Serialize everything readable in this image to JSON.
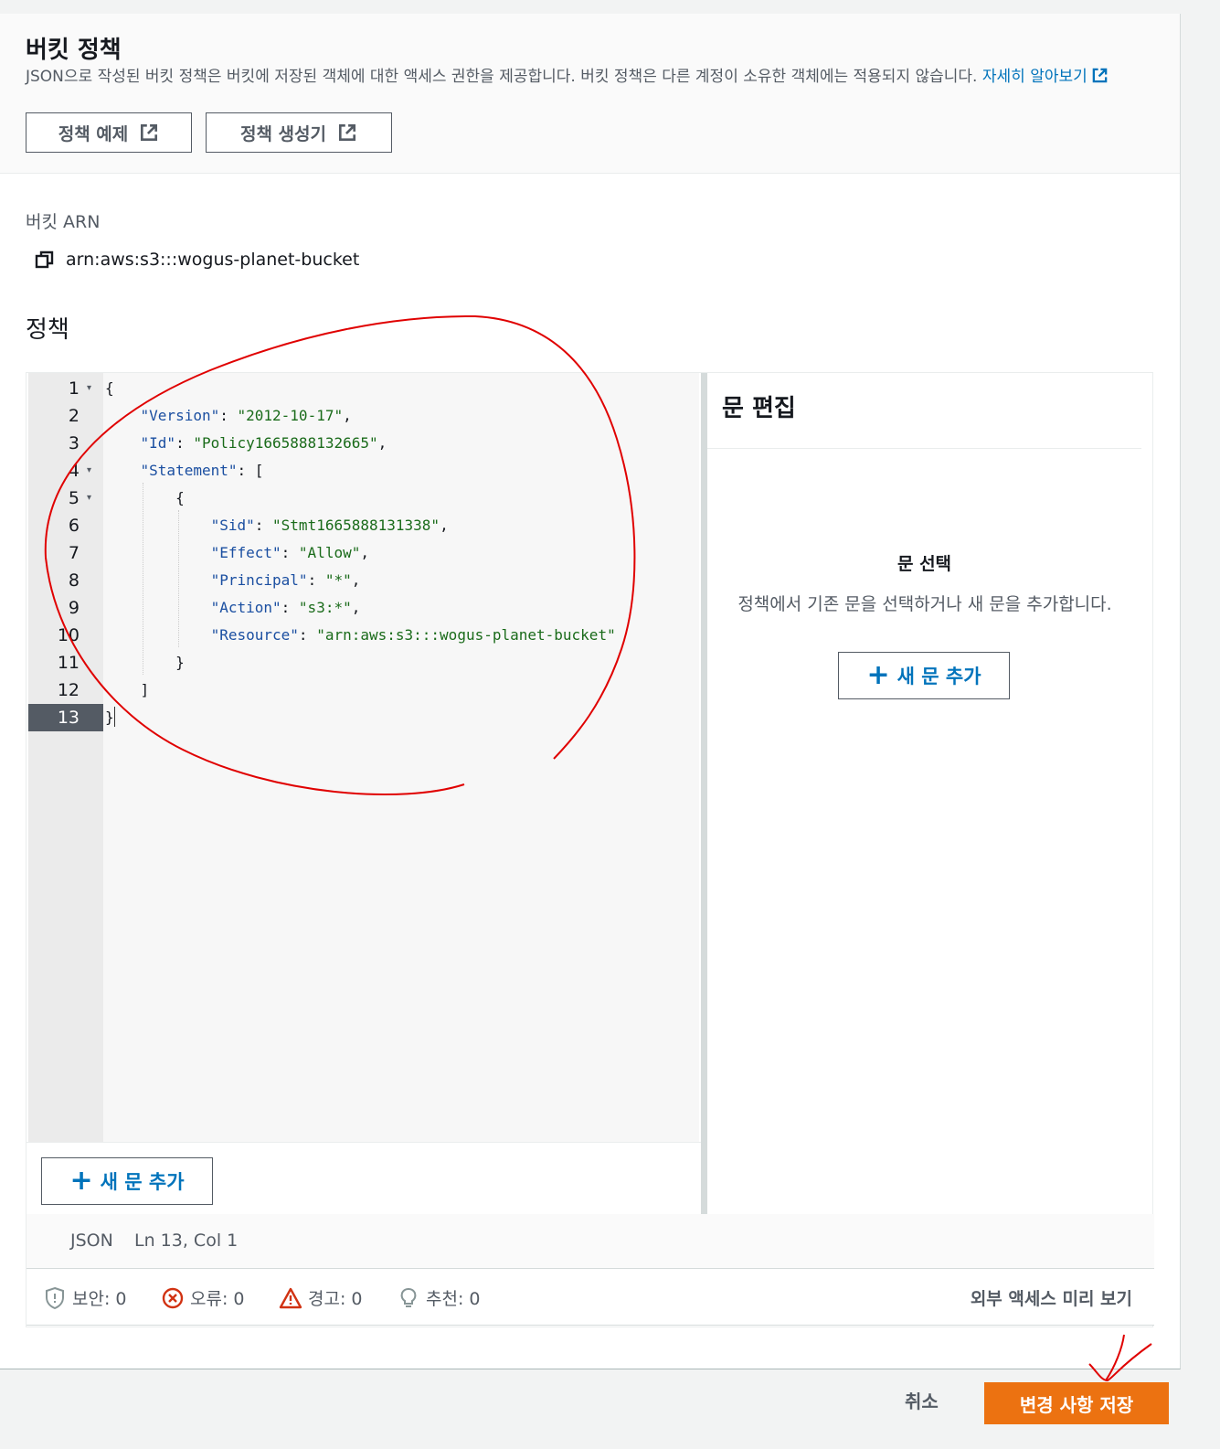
{
  "header": {
    "title": "버킷 정책",
    "description": "JSON으로 작성된 버킷 정책은 버킷에 저장된 객체에 대한 액세스 권한을 제공합니다. 버킷 정책은 다른 계정이 소유한 객체에는 적용되지 않습니다.",
    "learn_more": "자세히 알아보기",
    "policy_examples_button": "정책 예제",
    "policy_generator_button": "정책 생성기"
  },
  "arn": {
    "label": "버킷 ARN",
    "value": "arn:aws:s3:::wogus-planet-bucket"
  },
  "policy": {
    "label": "정책",
    "lines": [
      {
        "no": "1",
        "fold": true
      },
      {
        "no": "2",
        "fold": false
      },
      {
        "no": "3",
        "fold": false
      },
      {
        "no": "4",
        "fold": true
      },
      {
        "no": "5",
        "fold": true
      },
      {
        "no": "6",
        "fold": false
      },
      {
        "no": "7",
        "fold": false
      },
      {
        "no": "8",
        "fold": false
      },
      {
        "no": "9",
        "fold": false
      },
      {
        "no": "10",
        "fold": false
      },
      {
        "no": "11",
        "fold": false
      },
      {
        "no": "12",
        "fold": false
      },
      {
        "no": "13",
        "fold": false
      }
    ],
    "code": {
      "version_key": "\"Version\"",
      "version_val": "\"2012-10-17\"",
      "id_key": "\"Id\"",
      "id_val": "\"Policy1665888132665\"",
      "statement_key": "\"Statement\"",
      "sid_key": "\"Sid\"",
      "sid_val": "\"Stmt1665888131338\"",
      "effect_key": "\"Effect\"",
      "effect_val": "\"Allow\"",
      "principal_key": "\"Principal\"",
      "principal_val": "\"*\"",
      "action_key": "\"Action\"",
      "action_val": "\"s3:*\"",
      "resource_key": "\"Resource\"",
      "resource_val": "\"arn:aws:s3:::wogus-planet-bucket\""
    },
    "active_line": "13"
  },
  "editor": {
    "add_statement_button": "새 문 추가",
    "mode": "JSON",
    "cursor_position": "Ln 13, Col 1"
  },
  "statement_pane": {
    "title": "문 편집",
    "choose_title": "문 선택",
    "choose_desc": "정책에서 기존 문을 선택하거나 새 문을 추가합니다.",
    "add_statement_button": "새 문 추가"
  },
  "findings": {
    "security": "보안: 0",
    "errors": "오류: 0",
    "warnings": "경고: 0",
    "suggestions": "추천: 0",
    "preview_external_access": "외부 액세스 미리 보기"
  },
  "footer": {
    "cancel": "취소",
    "save": "변경 사항 저장"
  },
  "colors": {
    "link": "#0073bb",
    "primary": "#ec7211",
    "error": "#d13212",
    "annotation": "#e00000"
  }
}
